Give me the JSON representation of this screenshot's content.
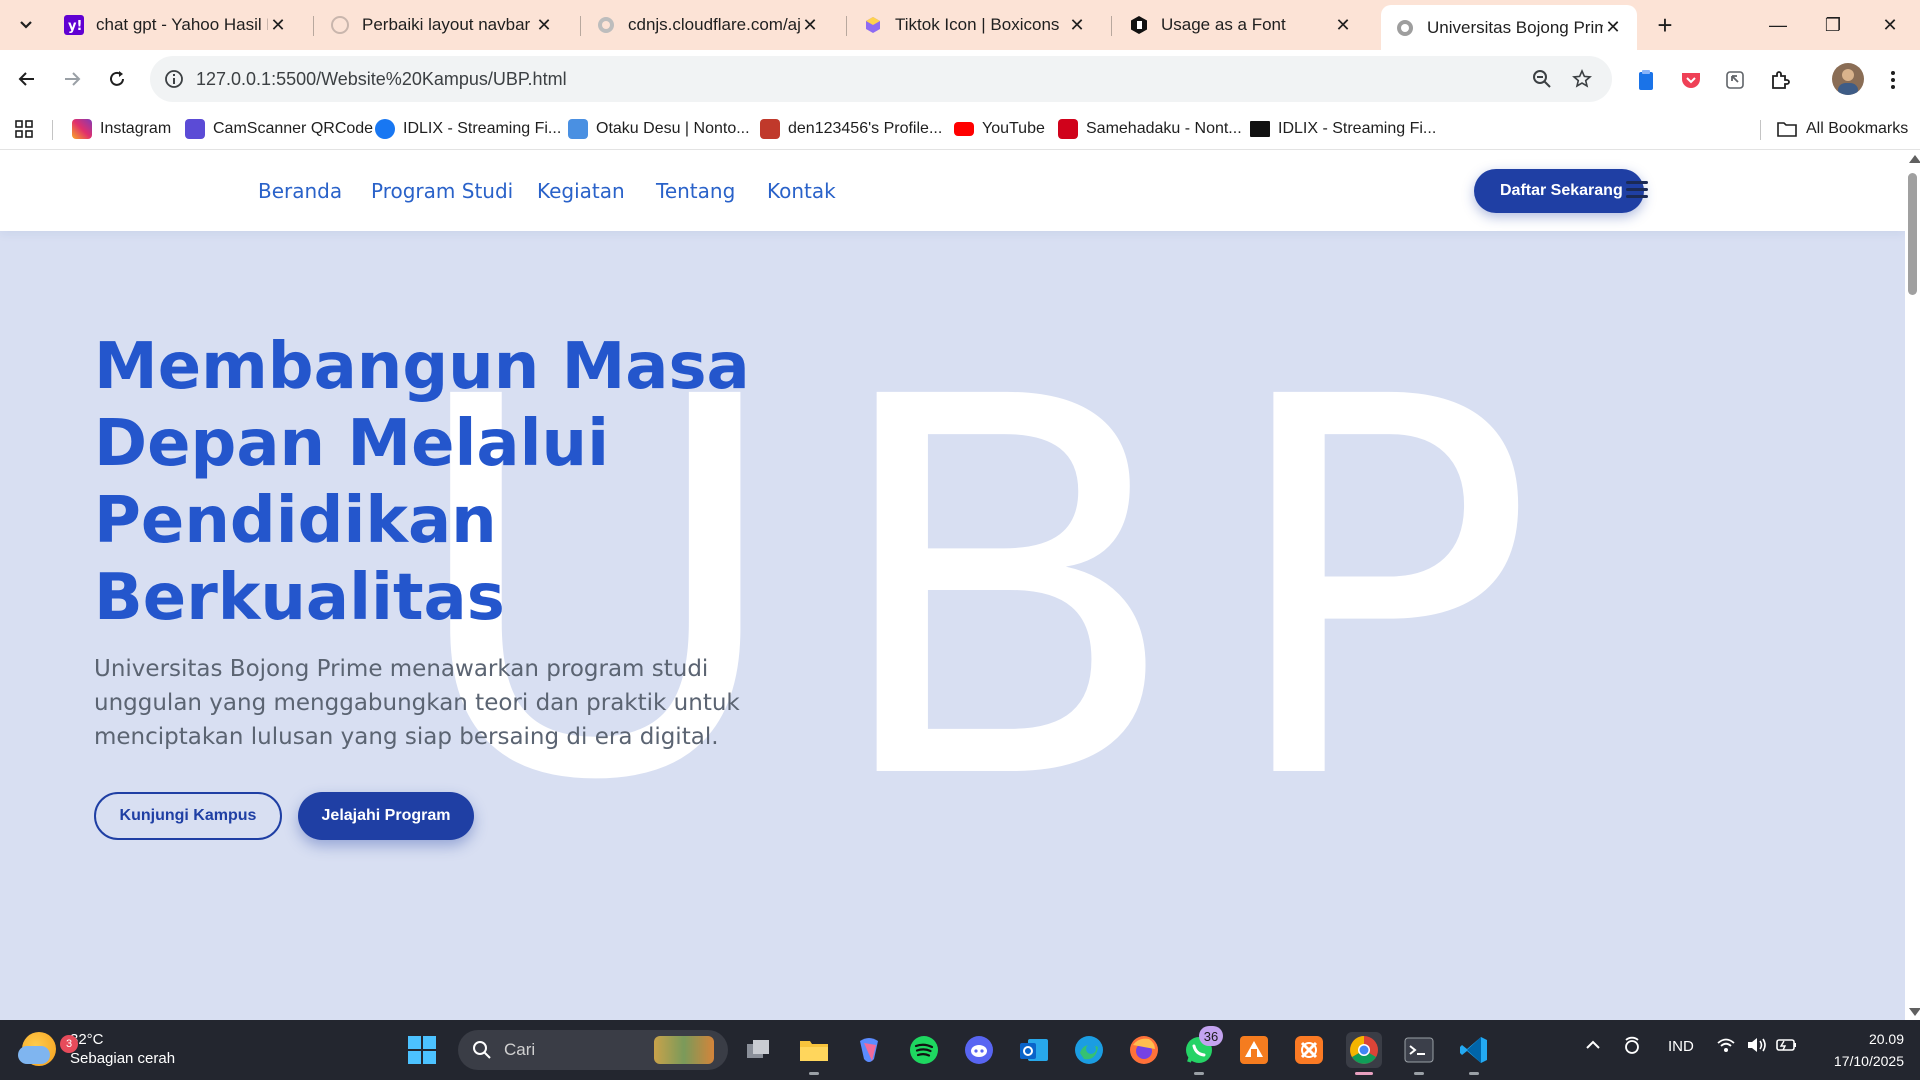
{
  "browser": {
    "tabs": [
      {
        "title": "chat gpt - Yahoo Hasil Pen",
        "icon": "yahoo-icon"
      },
      {
        "title": "Perbaiki layout navbar",
        "icon": "openai-icon"
      },
      {
        "title": "cdnjs.cloudflare.com/ajax/l",
        "icon": "globe-icon"
      },
      {
        "title": "Tiktok Icon | Boxicons",
        "icon": "boxicons-icon"
      },
      {
        "title": "Usage as a Font",
        "icon": "fontawesome-icon"
      },
      {
        "title": "Universitas Bojong Prime",
        "icon": "globe-icon",
        "active": true
      }
    ],
    "url": "127.0.0.1:5500/Website%20Kampus/UBP.html",
    "bookmarks": [
      {
        "label": "Instagram",
        "color": "#e1306c"
      },
      {
        "label": "CamScanner QRCode",
        "color": "#5b4bd6"
      },
      {
        "label": "IDLIX - Streaming Fi...",
        "color": "#1877f2"
      },
      {
        "label": "Otaku Desu | Nonto...",
        "color": "#4a90e2"
      },
      {
        "label": "den123456's Profile...",
        "color": "#c0392b"
      },
      {
        "label": "YouTube",
        "color": "#ff0000"
      },
      {
        "label": "Samehadaku - Nont...",
        "color": "#d0021b"
      },
      {
        "label": "IDLIX - Streaming Fi...",
        "color": "#111111"
      }
    ],
    "all_bookmarks": "All Bookmarks"
  },
  "site": {
    "nav": [
      "Beranda",
      "Program Studi",
      "Kegiatan",
      "Tentang",
      "Kontak"
    ],
    "cta": "Daftar Sekarang",
    "watermark": "UBP",
    "hero_title": "Membangun Masa Depan Melalui Pendidikan Berkualitas",
    "hero_desc": "Universitas Bojong Prime menawarkan program studi unggulan yang menggabungkan teori dan praktik untuk menciptakan lulusan yang siap bersaing di era digital.",
    "btn_primary": "Jelajahi Program",
    "btn_secondary": "Kunjungi Kampus",
    "colors": {
      "primary": "#1f3fa4",
      "link": "#2a62c9",
      "hero_bg": "#d8dff2"
    }
  },
  "taskbar": {
    "weather": {
      "temp": "32°C",
      "desc": "Sebagian cerah",
      "badge": "3"
    },
    "search_placeholder": "Cari",
    "whatsapp_badge": "36",
    "language": "IND",
    "time": "20.09",
    "date": "17/10/2025"
  }
}
